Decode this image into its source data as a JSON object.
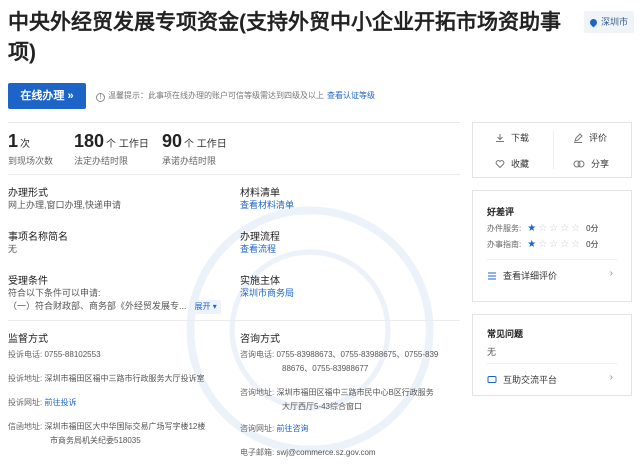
{
  "title": "中央外经贸发展专项资金(支持外贸中小企业开拓市场资助事项)",
  "city": "深圳市",
  "apply_button": "在线办理 »",
  "notice": {
    "text": "温馨提示：此事项在线办理的账户可信等级需达到四级及以上",
    "link": "查看认证等级"
  },
  "stats": [
    {
      "num": "1",
      "unit": "次",
      "label": "到现场次数"
    },
    {
      "num": "180",
      "unit": "个 工作日",
      "label": "法定办结时限"
    },
    {
      "num": "90",
      "unit": "个 工作日",
      "label": "承诺办结时限"
    }
  ],
  "fields": {
    "handling_form": {
      "label": "办理形式",
      "value": "网上办理,窗口办理,快递申请"
    },
    "materials": {
      "label": "材料清单",
      "link": "查看材料清单"
    },
    "alias": {
      "label": "事项名称简名",
      "value": "无"
    },
    "process": {
      "label": "办理流程",
      "link": "查看流程"
    },
    "conditions": {
      "label": "受理条件",
      "line1": "符合以下条件可以申请:",
      "line2": "（一）符合财政部、商务部《外经贸发展专...",
      "expand": "展开 ▾"
    },
    "subject": {
      "label": "实施主体",
      "link": "深圳市商务局"
    }
  },
  "supervision": {
    "label": "监督方式",
    "phone_k": "投诉电话:",
    "phone_v": "0755-88102553",
    "addr_k": "投诉地址:",
    "addr_v": "深圳市福田区福中三路市行政服务大厅投诉室",
    "web_k": "投诉网址:",
    "web_v": "前往投诉",
    "letter_k": "信函地址:",
    "letter_v1": "深圳市福田区大中华国际交易广场写字楼12楼",
    "letter_v2": "市商务局机关纪委518035"
  },
  "consult": {
    "label": "咨询方式",
    "phone_k": "咨询电话:",
    "phone_v1": "0755-83988673、0755-83988675、0755-839",
    "phone_v2": "88676、0755-83988677",
    "addr_k": "咨询地址:",
    "addr_v1": "深圳市福田区福中三路市民中心B区行政服务",
    "addr_v2": "大厅西厅5-43综合窗口",
    "web_k": "咨询网址:",
    "web_v": "前往咨询",
    "email_k": "电子邮箱:",
    "email_v": "swj@commerce.sz.gov.com"
  },
  "actions": {
    "download": "下载",
    "evaluate": "评价",
    "favorite": "收藏",
    "share": "分享"
  },
  "rating": {
    "title": "好差评",
    "rows": [
      {
        "label": "办件服务:",
        "score": "0分",
        "stars": 1
      },
      {
        "label": "办事指南:",
        "score": "0分",
        "stars": 1
      }
    ],
    "detail_link": "查看详细评价"
  },
  "faq": {
    "title": "常见问题",
    "value": "无",
    "platform": "互助交流平台"
  },
  "colors": {
    "brand": "#1c64c8"
  }
}
